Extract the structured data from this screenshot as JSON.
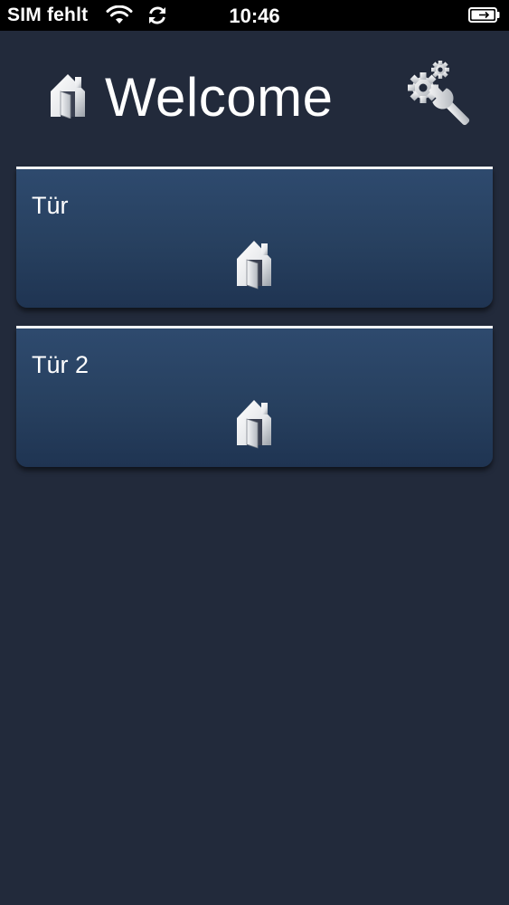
{
  "status_bar": {
    "carrier": "SIM fehlt",
    "time": "10:46",
    "icons": [
      "wifi-icon",
      "sync-icon",
      "battery-icon"
    ]
  },
  "header": {
    "title": "Welcome",
    "icons": [
      "home-door-icon",
      "settings-wrench-icon"
    ]
  },
  "doors": [
    {
      "label": "Tür",
      "icon": "home-door-icon"
    },
    {
      "label": "Tür 2",
      "icon": "home-door-icon"
    }
  ],
  "colors": {
    "background": "#222a3b",
    "card_top": "#2e4a6e",
    "card_bottom": "#1f3452",
    "card_border": "#f1f3f6",
    "text": "#ffffff"
  }
}
